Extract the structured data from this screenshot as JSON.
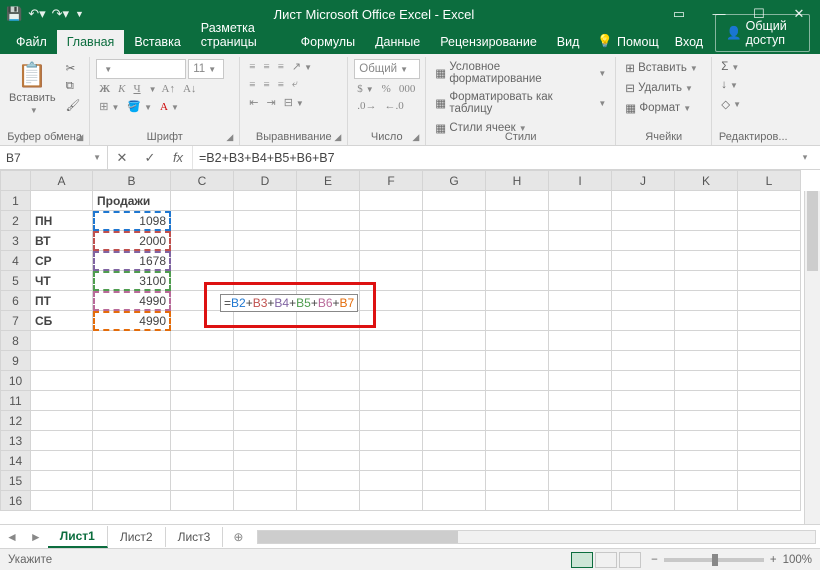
{
  "titlebar": {
    "title": "Лист Microsoft Office Excel - Excel"
  },
  "tabs": {
    "file": "Файл",
    "home": "Главная",
    "insert": "Вставка",
    "pagelayout": "Разметка страницы",
    "formulas": "Формулы",
    "data": "Данные",
    "review": "Рецензирование",
    "view": "Вид",
    "help": "Помощ",
    "signin": "Вход",
    "share": "Общий доступ"
  },
  "ribbon": {
    "clipboard": {
      "paste": "Вставить",
      "label": "Буфер обмена"
    },
    "font": {
      "name": "",
      "size": "11",
      "b": "Ж",
      "i": "К",
      "u": "Ч",
      "label": "Шрифт"
    },
    "alignment": {
      "label": "Выравнивание"
    },
    "number": {
      "format": "Общий",
      "label": "Число"
    },
    "styles": {
      "cond": "Условное форматирование",
      "table": "Форматировать как таблицу",
      "cell": "Стили ячеек",
      "label": "Стили"
    },
    "cells": {
      "insert": "Вставить",
      "delete": "Удалить",
      "format": "Формат",
      "label": "Ячейки"
    },
    "editing": {
      "label": "Редактиров..."
    }
  },
  "fbar": {
    "namebox": "B7",
    "fx": "fx",
    "formula": "=B2+B3+B4+B5+B6+B7"
  },
  "grid": {
    "cols": [
      "A",
      "B",
      "C",
      "D",
      "E",
      "F",
      "G",
      "H",
      "I",
      "J",
      "K",
      "L"
    ],
    "rows": [
      "1",
      "2",
      "3",
      "4",
      "5",
      "6",
      "7",
      "8",
      "9",
      "10",
      "11",
      "12",
      "13",
      "14",
      "15",
      "16"
    ],
    "header_b1": "Продажи",
    "days": {
      "a2": "ПН",
      "a3": "ВТ",
      "a4": "СР",
      "a5": "ЧТ",
      "a6": "ПТ",
      "a7": "СБ"
    },
    "vals": {
      "b2": "1098",
      "b3": "2000",
      "b4": "1678",
      "b5": "3100",
      "b6": "4990",
      "b7": "4990"
    },
    "edit_formula_parts": {
      "eq": "=",
      "p1": "B2",
      "p2": "B3",
      "p3": "B4",
      "p4": "B5",
      "p5": "B6",
      "p6": "B7",
      "plus": "+"
    }
  },
  "sheets": {
    "s1": "Лист1",
    "s2": "Лист2",
    "s3": "Лист3"
  },
  "status": {
    "mode": "Укажите",
    "zoom": "100%"
  }
}
